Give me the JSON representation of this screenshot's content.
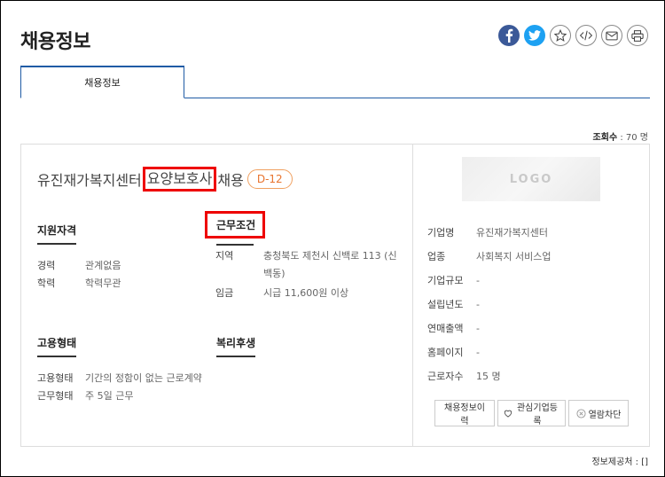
{
  "page_title": "채용정보",
  "share": {
    "facebook_icon": "facebook-icon",
    "twitter_icon": "twitter-icon",
    "favorite_icon": "star-icon",
    "embed_icon": "code-icon",
    "mail_icon": "mail-icon",
    "print_icon": "print-icon"
  },
  "tabs": [
    {
      "label": "채용정보",
      "active": true
    }
  ],
  "views": {
    "label": "조회수",
    "value": " : 70 명"
  },
  "job": {
    "title_prefix": "유진재가복지센터",
    "title_highlight": "요양보호사",
    "title_suffix": "채용",
    "dday": "D-12"
  },
  "qualification": {
    "heading": "지원자격",
    "rows": [
      {
        "key": "경력",
        "value": "관계없음"
      },
      {
        "key": "학력",
        "value": "학력무관"
      }
    ]
  },
  "conditions": {
    "heading": "근무조건",
    "rows": [
      {
        "key": "지역",
        "value": "충청북도 제천시 신백로 113 (신",
        "value2": "백동)"
      },
      {
        "key": "임금",
        "value": "시급 11,600원 이상"
      }
    ]
  },
  "employment": {
    "heading": "고용형태",
    "rows": [
      {
        "key": "고용형태",
        "value": "기간의 정함이 없는 근로계약"
      },
      {
        "key": "근무형태",
        "value": "주 5일 근무"
      }
    ]
  },
  "welfare": {
    "heading": "복리후생"
  },
  "company": {
    "logo_text": "LOGO",
    "rows": [
      {
        "key": "기업명",
        "value": "유진재가복지센터"
      },
      {
        "key": "업종",
        "value": "사회복지 서비스업"
      },
      {
        "key": "기업규모",
        "value": "-"
      },
      {
        "key": "설립년도",
        "value": "-"
      },
      {
        "key": "연매출액",
        "value": "-"
      },
      {
        "key": "홈페이지",
        "value": "-"
      },
      {
        "key": "근로자수",
        "value": "15 명"
      }
    ]
  },
  "actions": {
    "history": "채용정보이력",
    "interest": "관심기업등록",
    "block": "열람차단"
  },
  "provider": {
    "label": "정보제공처 : []"
  },
  "colors": {
    "accent": "#1f5ba5",
    "highlight": "#e00000",
    "dday": "#e8742e"
  }
}
